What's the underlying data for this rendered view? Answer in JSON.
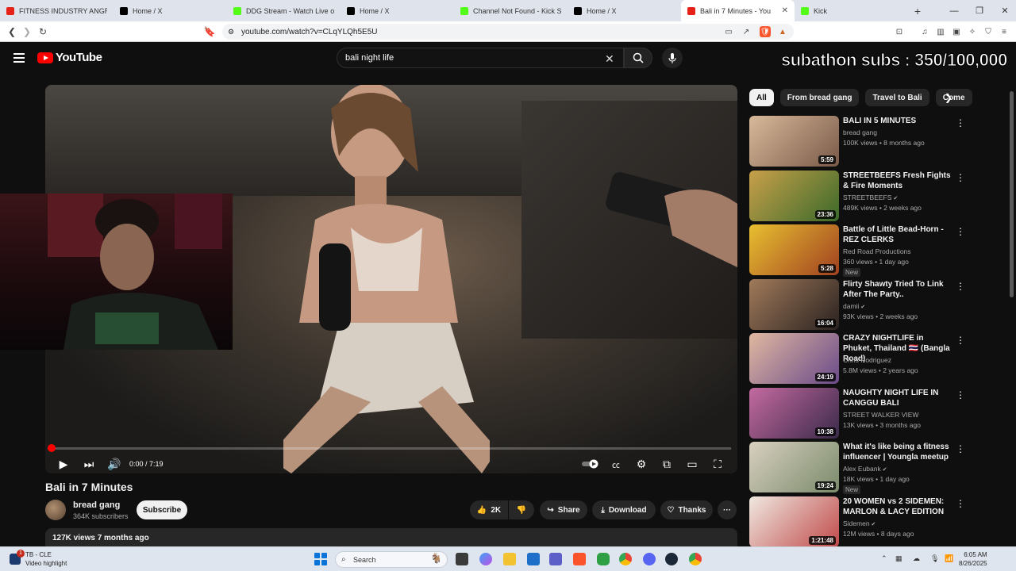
{
  "browser": {
    "tabs": [
      {
        "title": "FITNESS INDUSTRY ANGRY RA",
        "favicon": "youtube-icon",
        "color": "#e62117",
        "active": false
      },
      {
        "title": "Home / X",
        "favicon": "x-icon",
        "color": "#000000",
        "active": false
      },
      {
        "title": "DDG Stream - Watch Live on K",
        "favicon": "kick-icon",
        "color": "#53fc18",
        "active": false
      },
      {
        "title": "Home / X",
        "favicon": "x-icon",
        "color": "#000000",
        "active": false
      },
      {
        "title": "Channel Not Found - Kick Stre",
        "favicon": "kick-icon",
        "color": "#53fc18",
        "active": false
      },
      {
        "title": "Home / X",
        "favicon": "x-icon",
        "color": "#000000",
        "active": false
      },
      {
        "title": "Bali in 7 Minutes - You",
        "favicon": "youtube-icon",
        "color": "#e62117",
        "active": true
      },
      {
        "title": "Kick",
        "favicon": "kick-icon",
        "color": "#53fc18",
        "active": false
      }
    ],
    "new_tab": "+",
    "url": "youtube.com/watch?v=CLqYLQh5E5U"
  },
  "youtube": {
    "logo": "YouTube",
    "search_query": "bali night life",
    "overlay": "subathon subs : 350/100,000",
    "player": {
      "time": "0:00 / 7:19",
      "progress": 0.0
    },
    "video": {
      "title": "Bali in 7 Minutes",
      "channel": "bread gang",
      "subscribers": "364K subscribers",
      "subscribe": "Subscribe",
      "likes": "2K",
      "share": "Share",
      "download": "Download",
      "thanks": "Thanks",
      "more": "···",
      "views_line": "127K views  7 months ago"
    },
    "chips": [
      "All",
      "From bread gang",
      "Travel to Bali",
      "Come"
    ],
    "recommendations": [
      {
        "title": "BALI IN 5 MINUTES",
        "channel": "bread gang",
        "meta": "100K views • 8 months ago",
        "duration": "5:59",
        "verified": false,
        "new": ""
      },
      {
        "title": "STREETBEEFS Fresh Fights & Fire Moments",
        "channel": "STREETBEEFS",
        "meta": "489K views • 2 weeks ago",
        "duration": "23:36",
        "verified": true,
        "new": ""
      },
      {
        "title": "Battle of Little Bead-Horn - REZ CLERKS",
        "channel": "Red Road Productions",
        "meta": "360 views • 1 day ago",
        "duration": "5:28",
        "verified": false,
        "new": "New"
      },
      {
        "title": "Flirty Shawty Tried To Link After The Party..",
        "channel": "damii",
        "meta": "93K views • 2 weeks ago",
        "duration": "16:04",
        "verified": true,
        "new": ""
      },
      {
        "title": "CRAZY NIGHTLIFE in Phuket, Thailand 🇹🇭 (Bangla Road)",
        "channel": "Chris Rodriguez",
        "meta": "5.8M views • 2 years ago",
        "duration": "24:19",
        "verified": false,
        "new": ""
      },
      {
        "title": "NAUGHTY NIGHT LIFE IN CANGGU BALI",
        "channel": "STREET WALKER VIEW",
        "meta": "13K views • 3 months ago",
        "duration": "10:38",
        "verified": false,
        "new": ""
      },
      {
        "title": "What it's like being a fitness influencer | Youngla meetup",
        "channel": "Alex Eubank",
        "meta": "18K views • 1 day ago",
        "duration": "19:24",
        "verified": true,
        "new": "New"
      },
      {
        "title": "20 WOMEN vs 2 SIDEMEN: MARLON & LACY EDITION",
        "channel": "Sidemen",
        "meta": "12M views • 8 days ago",
        "duration": "1:21:48",
        "verified": true,
        "new": ""
      }
    ]
  },
  "taskbar": {
    "notif_title": "TB - CLE",
    "notif_sub": "Video highlight",
    "search": "Search",
    "time": "6:05 AM",
    "date": "8/26/2025"
  }
}
